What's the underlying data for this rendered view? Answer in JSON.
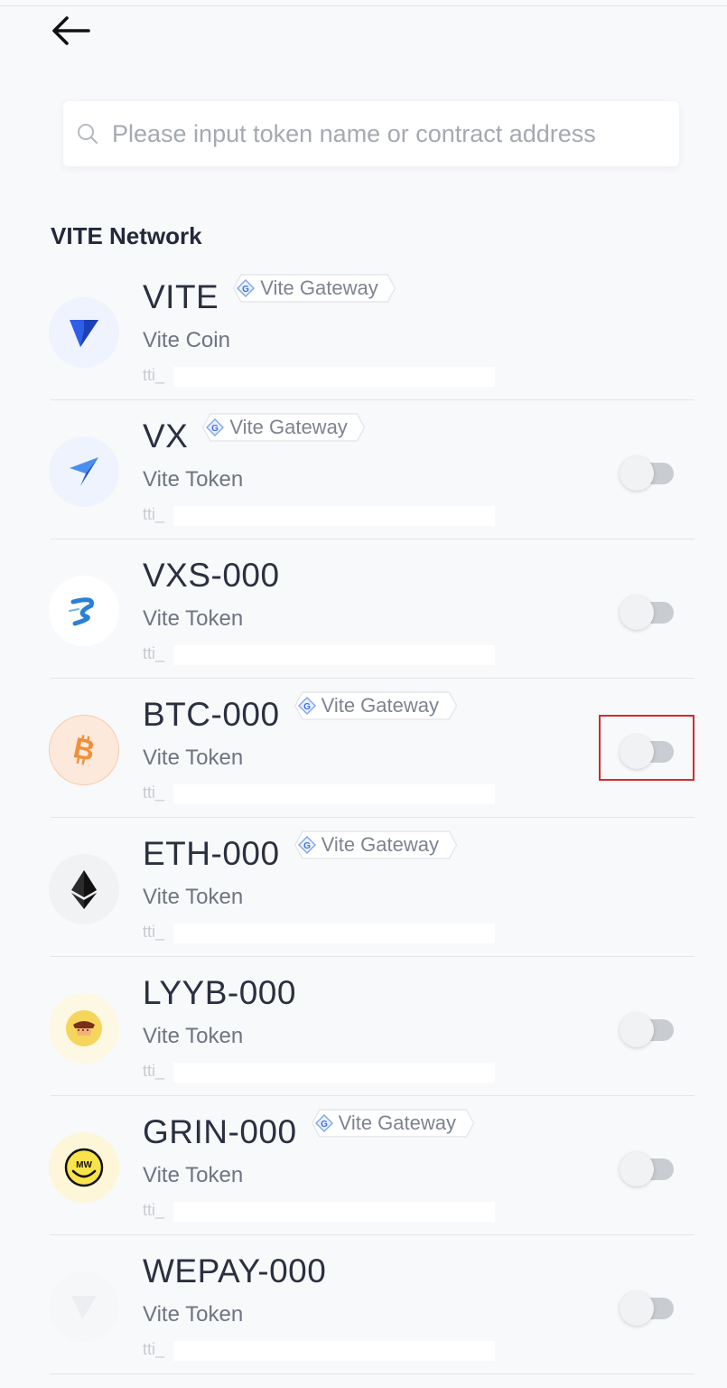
{
  "search": {
    "placeholder": "Please input token name or contract address",
    "value": ""
  },
  "section": {
    "title": "VITE Network"
  },
  "tokens": [
    {
      "name": "VITE",
      "gateway": "Vite Gateway",
      "subname": "Vite Coin",
      "address": "tti_",
      "toggle": false,
      "logo": "vite-logo-icon"
    },
    {
      "name": "VX",
      "gateway": "Vite Gateway",
      "subname": "Vite Token",
      "address": "tti_",
      "toggle": true,
      "logo": "vx-logo-icon"
    },
    {
      "name": "VXS-000",
      "gateway": null,
      "subname": "Vite Token",
      "address": "tti_",
      "toggle": true,
      "logo": "vxs-logo-icon"
    },
    {
      "name": "BTC-000",
      "gateway": "Vite Gateway",
      "subname": "Vite Token",
      "address": "tti_",
      "toggle": true,
      "logo": "bitcoin-logo-icon"
    },
    {
      "name": "ETH-000",
      "gateway": "Vite Gateway",
      "subname": "Vite Token",
      "address": "tti_",
      "toggle": false,
      "logo": "ethereum-logo-icon"
    },
    {
      "name": "LYYB-000",
      "gateway": null,
      "subname": "Vite Token",
      "address": "tti_",
      "toggle": true,
      "logo": "lyyb-logo-icon"
    },
    {
      "name": "GRIN-000",
      "gateway": "Vite Gateway",
      "subname": "Vite Token",
      "address": "tti_",
      "toggle": true,
      "logo": "grin-logo-icon"
    },
    {
      "name": "WEPAY-000",
      "gateway": null,
      "subname": "Vite Token",
      "address": "tti_",
      "toggle": true,
      "logo": "wepay-logo-icon"
    }
  ],
  "colors": {
    "accent": "#2f6ef2",
    "highlight": "#d12d2d",
    "bitcoin": "#f18f3b"
  }
}
